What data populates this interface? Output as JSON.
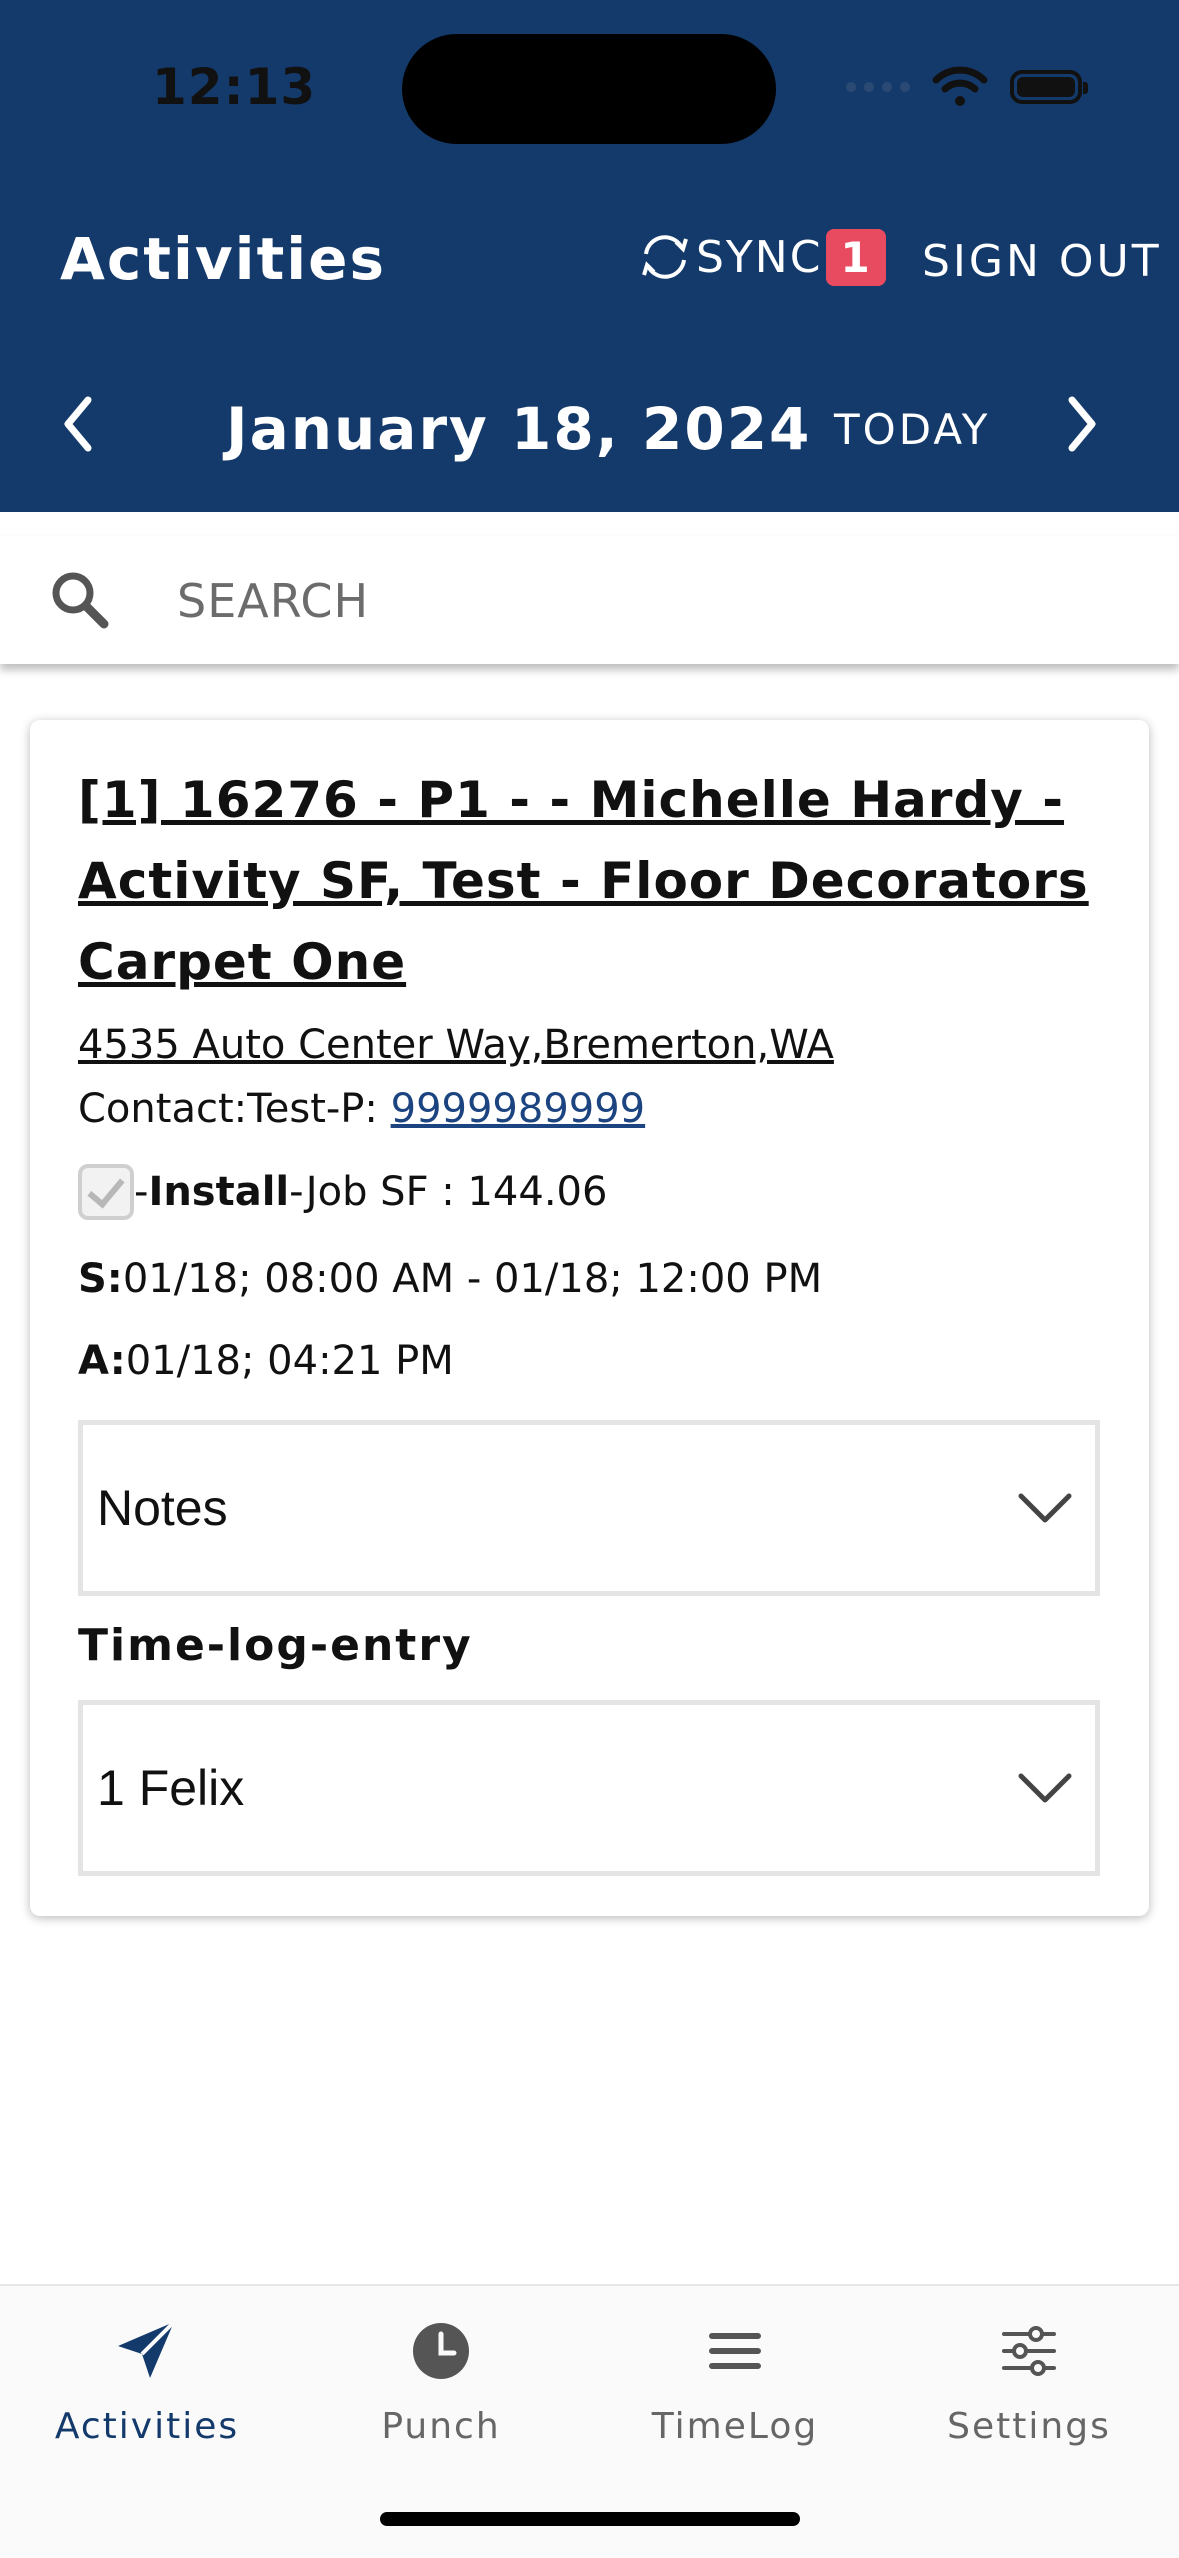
{
  "status_bar": {
    "time": "12:13"
  },
  "header": {
    "title": "Activities",
    "sync_label": "SYNC",
    "sync_count": "1",
    "signout_label": "SIGN OUT",
    "date": "January 18, 2024",
    "today_label": "TODAY"
  },
  "search": {
    "placeholder": "SEARCH"
  },
  "activity": {
    "title": "[1] 16276 - P1 - - Michelle Hardy - Activity SF, Test - Floor Decorators Carpet One",
    "address": "4535 Auto Center Way,Bremerton,WA",
    "contact_prefix": "Contact:Test-P: ",
    "phone": "9999989999",
    "job_dash": "-",
    "job_type": "Install",
    "job_sf": "-Job SF : 144.06",
    "scheduled_label": "S:",
    "scheduled_value": "01/18; 08:00 AM - 01/18; 12:00 PM",
    "actual_label": "A:",
    "actual_value": "01/18; 04:21 PM",
    "notes_label": "Notes",
    "timelog_section_label": "Time-log-entry",
    "timelog_selected": "1 Felix"
  },
  "tabs": [
    {
      "label": "Activities",
      "icon": "paper-plane-icon",
      "active": true
    },
    {
      "label": "Punch",
      "icon": "clock-icon",
      "active": false
    },
    {
      "label": "TimeLog",
      "icon": "list-icon",
      "active": false
    },
    {
      "label": "Settings",
      "icon": "sliders-icon",
      "active": false
    }
  ],
  "colors": {
    "header_bg": "#143a6c",
    "badge": "#e84b5f",
    "link": "#1b4480"
  }
}
